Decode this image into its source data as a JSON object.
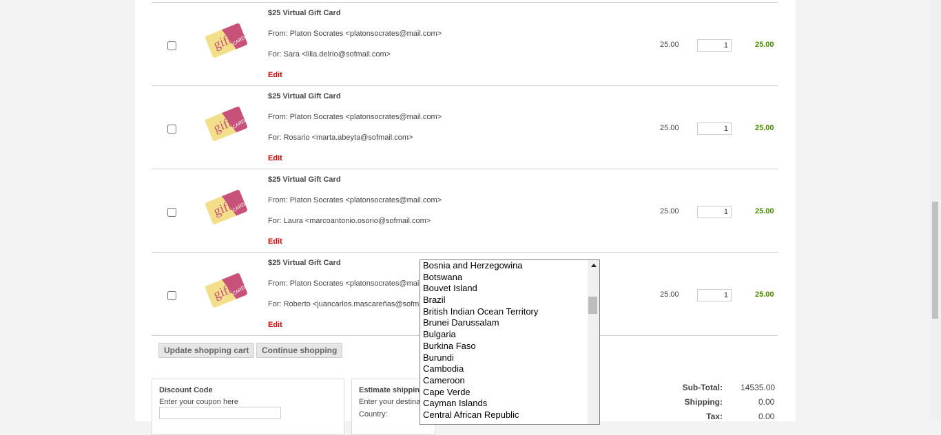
{
  "cart": {
    "items": [
      {
        "title": "$25 Virtual Gift Card",
        "from": "From: Platon Socrates <platonsocrates@mail.com>",
        "for": "For: Sara <lilia.delrío@sofmail.com>",
        "edit": "Edit",
        "unit_price": "25.00",
        "quantity": "1",
        "total": "25.00",
        "image": "gift-card-icon"
      },
      {
        "title": "$25 Virtual Gift Card",
        "from": "From: Platon Socrates <platonsocrates@mail.com>",
        "for": "For: Rosario <marta.abeyta@sofmail.com>",
        "edit": "Edit",
        "unit_price": "25.00",
        "quantity": "1",
        "total": "25.00",
        "image": "gift-card-icon"
      },
      {
        "title": "$25 Virtual Gift Card",
        "from": "From: Platon Socrates <platonsocrates@mail.com>",
        "for": "For: Laura <marcoantonio.osorio@sofmail.com>",
        "edit": "Edit",
        "unit_price": "25.00",
        "quantity": "1",
        "total": "25.00",
        "image": "gift-card-icon"
      },
      {
        "title": "$25 Virtual Gift Card",
        "from": "From: Platon Socrates <platonsocrates@mai",
        "for": "For: Roberto <juancarlos.mascareñas@sofm",
        "edit": "Edit",
        "unit_price": "25.00",
        "quantity": "1",
        "total": "25.00",
        "image": "gift-card-icon"
      }
    ],
    "update_button": "Update shopping cart",
    "continue_button": "Continue shopping"
  },
  "gift_card_image": {
    "word": "gift",
    "card_word": "CARD",
    "colors": {
      "yellow": "#f3df8a",
      "pink": "#c8517a"
    }
  },
  "discount": {
    "title": "Discount Code",
    "subtitle": "Enter your coupon here",
    "coupon_value": ""
  },
  "shipping": {
    "title": "Estimate shippin",
    "subtitle": "Enter your destina",
    "country_label": "Country:"
  },
  "country_dropdown": {
    "options": [
      "Bosnia and Herzegowina",
      "Botswana",
      "Bouvet Island",
      "Brazil",
      "British Indian Ocean Territory",
      "Brunei Darussalam",
      "Bulgaria",
      "Burkina Faso",
      "Burundi",
      "Cambodia",
      "Cameroon",
      "Cape Verde",
      "Cayman Islands",
      "Central African Republic"
    ]
  },
  "totals": {
    "subtotal_label": "Sub-Total:",
    "subtotal_value": "14535.00",
    "shipping_label": "Shipping:",
    "shipping_value": "0.00",
    "tax_label": "Tax:",
    "tax_value": "0.00"
  },
  "colors": {
    "accent_edit": "#cc0000",
    "line_total": "#4a8a00",
    "page_background": "#f3f3f3"
  }
}
